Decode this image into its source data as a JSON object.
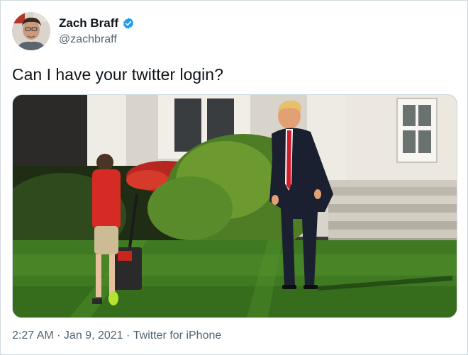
{
  "tweet": {
    "author": {
      "display_name": "Zach Braff",
      "handle": "@zachbraff",
      "verified": true,
      "verified_color": "#1d9bf0"
    },
    "text": "Can I have your twitter login?",
    "time": "2:27 AM",
    "date": "Jan 9, 2021",
    "source": "Twitter for iPhone",
    "separator": " · "
  },
  "colors": {
    "text_primary": "#0f1419",
    "text_secondary": "#536471",
    "border": "#cfd9de"
  }
}
